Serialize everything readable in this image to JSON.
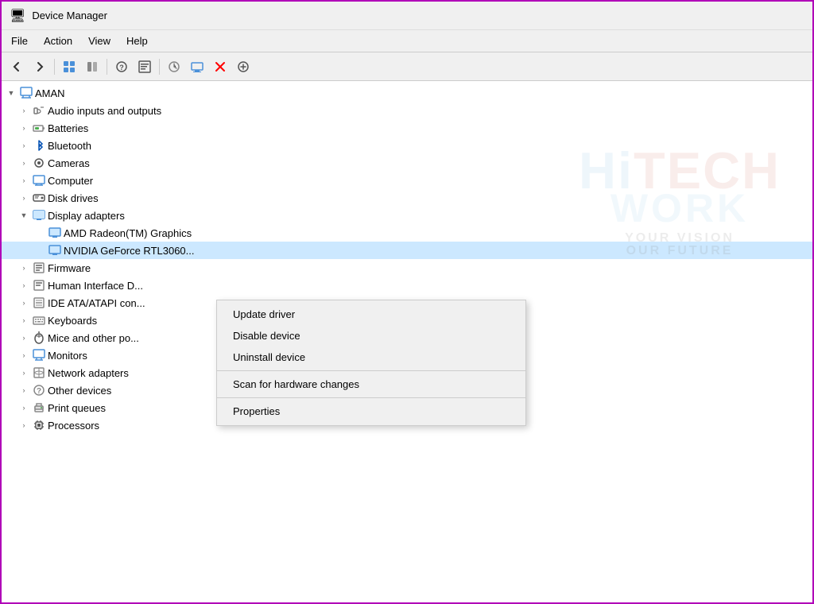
{
  "window": {
    "title": "Device Manager",
    "title_icon": "device-manager"
  },
  "menubar": {
    "items": [
      {
        "id": "file",
        "label": "File"
      },
      {
        "id": "action",
        "label": "Action"
      },
      {
        "id": "view",
        "label": "View"
      },
      {
        "id": "help",
        "label": "Help"
      }
    ]
  },
  "toolbar": {
    "buttons": [
      {
        "id": "back",
        "icon": "←",
        "title": "Back"
      },
      {
        "id": "forward",
        "icon": "→",
        "title": "Forward"
      },
      {
        "id": "show-all",
        "icon": "⊞",
        "title": "Show/hide all"
      },
      {
        "id": "show-hidden",
        "icon": "⊟",
        "title": "Show hidden"
      },
      {
        "id": "properties",
        "icon": "?",
        "title": "Properties"
      },
      {
        "id": "resources",
        "icon": "⊠",
        "title": "Resources"
      },
      {
        "id": "scan",
        "icon": "⚙",
        "title": "Scan for hardware changes"
      },
      {
        "id": "monitor",
        "icon": "🖥",
        "title": "Update driver"
      },
      {
        "id": "uninstall",
        "icon": "✕",
        "title": "Uninstall"
      },
      {
        "id": "download",
        "icon": "⊕",
        "title": "Add legacy hardware"
      }
    ]
  },
  "tree": {
    "root": {
      "label": "AMAN",
      "expanded": true
    },
    "items": [
      {
        "id": "audio",
        "label": "Audio inputs and outputs",
        "icon": "audio",
        "indent": 1,
        "expanded": false
      },
      {
        "id": "batteries",
        "label": "Batteries",
        "icon": "batteries",
        "indent": 1,
        "expanded": false
      },
      {
        "id": "bluetooth",
        "label": "Bluetooth",
        "icon": "bluetooth",
        "indent": 1,
        "expanded": false
      },
      {
        "id": "cameras",
        "label": "Cameras",
        "icon": "camera",
        "indent": 1,
        "expanded": false
      },
      {
        "id": "computer",
        "label": "Computer",
        "icon": "computer",
        "indent": 1,
        "expanded": false
      },
      {
        "id": "disk",
        "label": "Disk drives",
        "icon": "disk",
        "indent": 1,
        "expanded": false
      },
      {
        "id": "display",
        "label": "Display adapters",
        "icon": "display",
        "indent": 1,
        "expanded": true
      },
      {
        "id": "amd",
        "label": "AMD Radeon(TM) Graphics",
        "icon": "display",
        "indent": 2,
        "expanded": false
      },
      {
        "id": "nvidia",
        "label": "NVIDIA GeForce RTL3060...",
        "icon": "display",
        "indent": 2,
        "expanded": false,
        "selected": true
      },
      {
        "id": "firmware",
        "label": "Firmware",
        "icon": "firmware",
        "indent": 1,
        "expanded": false
      },
      {
        "id": "hid",
        "label": "Human Interface D...",
        "icon": "hid",
        "indent": 1,
        "expanded": false
      },
      {
        "id": "ide",
        "label": "IDE ATA/ATAPI con...",
        "icon": "ide",
        "indent": 1,
        "expanded": false
      },
      {
        "id": "keyboards",
        "label": "Keyboards",
        "icon": "keyboard",
        "indent": 1,
        "expanded": false
      },
      {
        "id": "mice",
        "label": "Mice and other po...",
        "icon": "mice",
        "indent": 1,
        "expanded": false
      },
      {
        "id": "monitors",
        "label": "Monitors",
        "icon": "monitor",
        "indent": 1,
        "expanded": false
      },
      {
        "id": "network",
        "label": "Network adapters",
        "icon": "network",
        "indent": 1,
        "expanded": false
      },
      {
        "id": "other",
        "label": "Other devices",
        "icon": "other",
        "indent": 1,
        "expanded": false
      },
      {
        "id": "print",
        "label": "Print queues",
        "icon": "print",
        "indent": 1,
        "expanded": false
      },
      {
        "id": "processors",
        "label": "Processors",
        "icon": "processor",
        "indent": 1,
        "expanded": false
      }
    ]
  },
  "context_menu": {
    "items": [
      {
        "id": "update-driver",
        "label": "Update driver",
        "separator_after": false
      },
      {
        "id": "disable-device",
        "label": "Disable device",
        "separator_after": false
      },
      {
        "id": "uninstall-device",
        "label": "Uninstall device",
        "separator_after": true
      },
      {
        "id": "scan-hardware",
        "label": "Scan for hardware changes",
        "separator_after": true
      },
      {
        "id": "properties",
        "label": "Properties",
        "separator_after": false
      }
    ]
  },
  "watermark": {
    "line1": "HiTECH",
    "line2": "WORK",
    "tagline1": "YOUR VISION",
    "tagline2": "OUR FUTURE"
  }
}
